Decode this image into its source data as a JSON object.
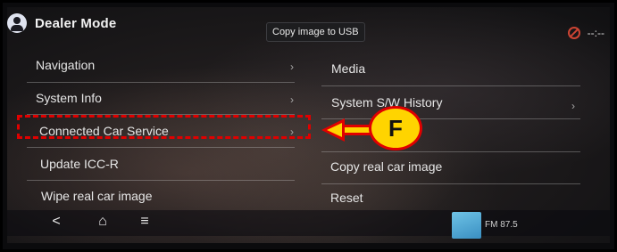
{
  "header": {
    "title": "Dealer Mode",
    "user_icon": "user-icon"
  },
  "tooltip": {
    "text": "Copy image to USB"
  },
  "status": {
    "clock": "--:--",
    "mute_icon": "mute-icon"
  },
  "menu": {
    "left": [
      {
        "label": "Navigation"
      },
      {
        "label": "System Info"
      },
      {
        "label": "Connected Car Service"
      },
      {
        "label": "Update ICC-R"
      },
      {
        "label": "Wipe real car image"
      }
    ],
    "right": [
      {
        "label": "Media"
      },
      {
        "label": "System S/W History"
      },
      {
        "label": "Copy real car image"
      },
      {
        "label": "Reset"
      }
    ]
  },
  "annotation": {
    "callout_letter": "F",
    "highlight_color": "#e00000",
    "callout_color": "#ffd400"
  },
  "bottom_nav": {
    "back": "<",
    "home": "⌂",
    "menu": "≡"
  },
  "radio": {
    "label": "FM 87.5"
  }
}
